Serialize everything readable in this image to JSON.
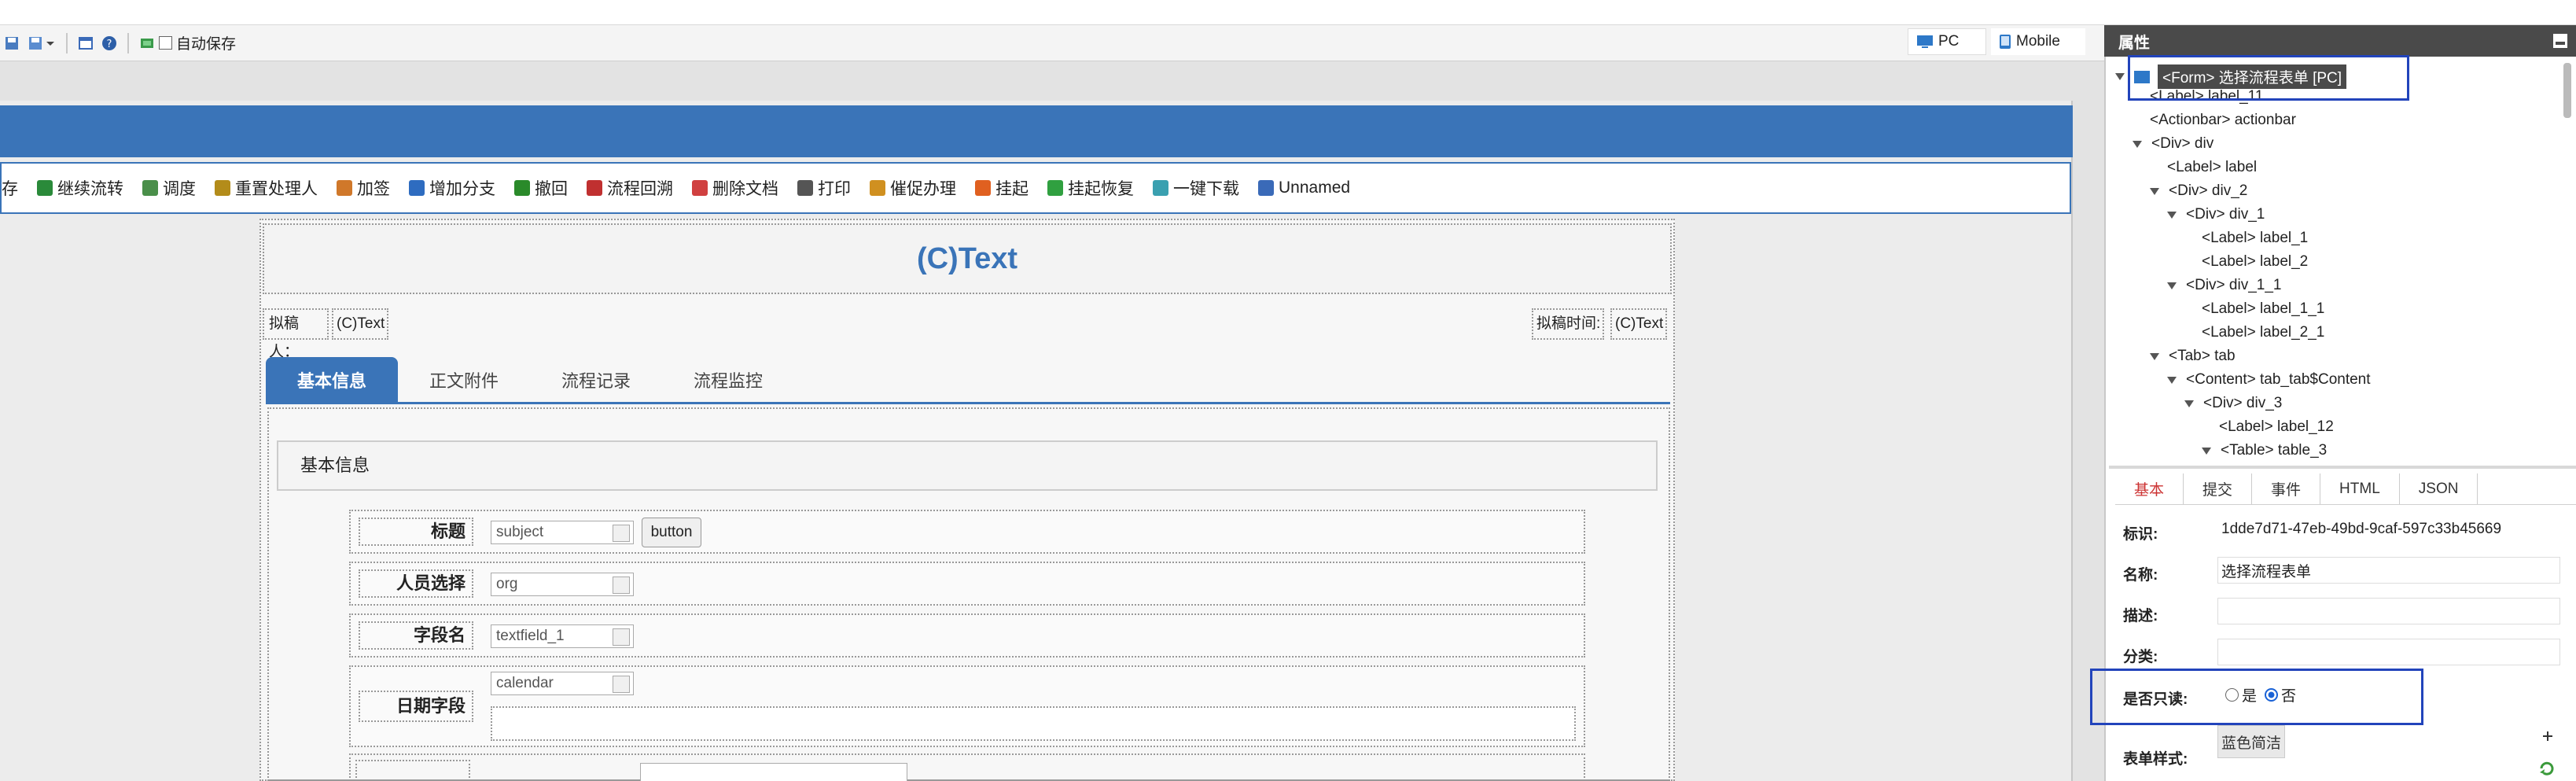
{
  "toolbar": {
    "autosave_label": "自动保存"
  },
  "modes": {
    "pc": "PC",
    "mobile": "Mobile"
  },
  "actions": [
    "存",
    "继续流转",
    "调度",
    "重置处理人",
    "加签",
    "增加分支",
    "撤回",
    "流程回溯",
    "删除文档",
    "打印",
    "催促办理",
    "挂起",
    "挂起恢复",
    "一键下载",
    "Unnamed"
  ],
  "action_colors": [
    "#7a5",
    "#2a8a3a",
    "#4a8f4a",
    "#b38c1a",
    "#d0782a",
    "#2e6cc0",
    "#2a8a2a",
    "#c03030",
    "#d04040",
    "#555555",
    "#d09020",
    "#e06020",
    "#30a040",
    "#3aa0b0",
    "#3a6ab8"
  ],
  "form": {
    "title": "(C)Text",
    "drafter_label": "拟稿人：",
    "drafter_value": "(C)Text",
    "draft_time_label": "拟稿时间:",
    "draft_time_value": "(C)Text",
    "tabs": [
      "基本信息",
      "正文附件",
      "流程记录",
      "流程监控"
    ],
    "section_title": "基本信息",
    "fields": [
      {
        "label": "标题",
        "value": "subject"
      },
      {
        "label": "人员选择",
        "value": "org"
      },
      {
        "label": "字段名",
        "value": "textfield_1"
      },
      {
        "label": "日期字段",
        "value": "calendar"
      }
    ],
    "button_label": "button"
  },
  "panel": {
    "title": "属性",
    "tree": [
      {
        "text": "<Form> 选择流程表单 [PC]",
        "depth": 0,
        "toggle": true
      },
      {
        "text": "<Label> label_11",
        "depth": 1,
        "toggle": false
      },
      {
        "text": "<Actionbar> actionbar",
        "depth": 1,
        "toggle": false
      },
      {
        "text": "<Div> div",
        "depth": 1,
        "toggle": true
      },
      {
        "text": "<Label> label",
        "depth": 2,
        "toggle": false
      },
      {
        "text": "<Div> div_2",
        "depth": 2,
        "toggle": true
      },
      {
        "text": "<Div> div_1",
        "depth": 3,
        "toggle": true
      },
      {
        "text": "<Label> label_1",
        "depth": 4,
        "toggle": false
      },
      {
        "text": "<Label> label_2",
        "depth": 4,
        "toggle": false
      },
      {
        "text": "<Div> div_1_1",
        "depth": 3,
        "toggle": true
      },
      {
        "text": "<Label> label_1_1",
        "depth": 4,
        "toggle": false
      },
      {
        "text": "<Label> label_2_1",
        "depth": 4,
        "toggle": false
      },
      {
        "text": "<Tab> tab",
        "depth": 2,
        "toggle": true
      },
      {
        "text": "<Content> tab_tab$Content",
        "depth": 3,
        "toggle": true
      },
      {
        "text": "<Div> div_3",
        "depth": 4,
        "toggle": true
      },
      {
        "text": "<Label> label_12",
        "depth": 5,
        "toggle": false
      },
      {
        "text": "<Table> table_3",
        "depth": 5,
        "toggle": true
      }
    ],
    "tabs": [
      "基本",
      "提交",
      "事件",
      "HTML",
      "JSON"
    ],
    "props": {
      "id_label": "标识:",
      "id_value": "1dde7d71-47eb-49bd-9caf-597c33b45669",
      "name_label": "名称:",
      "name_value": "选择流程表单",
      "desc_label": "描述:",
      "desc_value": "",
      "cat_label": "分类:",
      "cat_value": "",
      "readonly_label": "是否只读:",
      "yes": "是",
      "no": "否",
      "style_label": "表单样式:",
      "style_value": "蓝色简洁"
    }
  }
}
